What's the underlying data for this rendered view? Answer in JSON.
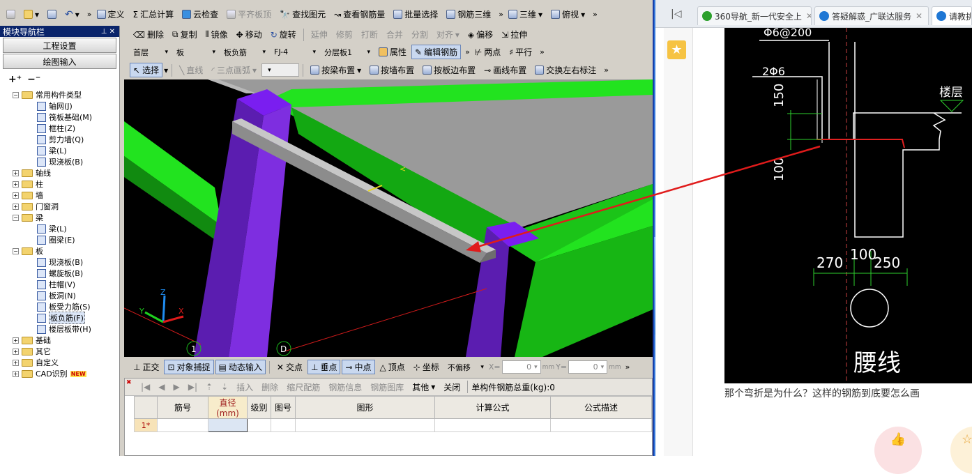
{
  "toolbar1": {
    "define": "定义",
    "sum_calc": "汇总计算",
    "cloud_check": "云检查",
    "level_top": "平齐板顶",
    "find_element": "查找图元",
    "view_rebar": "查看钢筋量",
    "batch_select": "批量选择",
    "rebar_3d": "钢筋三维",
    "view_mode": "三维",
    "view_dir": "俯视"
  },
  "toolbar2": {
    "delete": "删除",
    "copy": "复制",
    "mirror": "镜像",
    "move": "移动",
    "rotate": "旋转",
    "extend": "延伸",
    "trim": "修剪",
    "break": "打断",
    "merge": "合并",
    "split": "分割",
    "align": "对齐",
    "offset": "偏移",
    "stretch": "拉伸"
  },
  "toolbar3": {
    "floor": "首层",
    "type": "板",
    "subtype": "板负筋",
    "component": "FJ-4",
    "layer": "分层板1",
    "properties": "属性",
    "edit_rebar": "编辑钢筋",
    "two_points": "两点",
    "parallel": "平行"
  },
  "toolbar4": {
    "select": "选择",
    "line": "直线",
    "arc": "三点画弧",
    "by_beam": "按梁布置",
    "by_wall": "按墙布置",
    "by_slab_edge": "按板边布置",
    "draw_line": "画线布置",
    "swap_labels": "交换左右标注"
  },
  "nav": {
    "title": "模块导航栏",
    "project_settings": "工程设置",
    "drawing_input": "绘图输入",
    "tree": [
      {
        "label": "常用构件类型",
        "level": 0,
        "expanded": true,
        "children": [
          {
            "label": "轴网(J)"
          },
          {
            "label": "筏板基础(M)"
          },
          {
            "label": "框柱(Z)"
          },
          {
            "label": "剪力墙(Q)"
          },
          {
            "label": "梁(L)"
          },
          {
            "label": "现浇板(B)"
          }
        ]
      },
      {
        "label": "轴线",
        "level": 0,
        "expanded": false
      },
      {
        "label": "柱",
        "level": 0,
        "expanded": false
      },
      {
        "label": "墙",
        "level": 0,
        "expanded": false
      },
      {
        "label": "门窗洞",
        "level": 0,
        "expanded": false
      },
      {
        "label": "梁",
        "level": 0,
        "expanded": true,
        "children": [
          {
            "label": "梁(L)"
          },
          {
            "label": "圈梁(E)"
          }
        ]
      },
      {
        "label": "板",
        "level": 0,
        "expanded": true,
        "children": [
          {
            "label": "现浇板(B)"
          },
          {
            "label": "螺旋板(B)"
          },
          {
            "label": "柱帽(V)"
          },
          {
            "label": "板洞(N)"
          },
          {
            "label": "板受力筋(S)"
          },
          {
            "label": "板负筋(F)"
          },
          {
            "label": "楼层板带(H)"
          }
        ]
      },
      {
        "label": "基础",
        "level": 0,
        "expanded": false
      },
      {
        "label": "其它",
        "level": 0,
        "expanded": false
      },
      {
        "label": "自定义",
        "level": 0,
        "expanded": false
      },
      {
        "label": "CAD识别",
        "level": 0,
        "expanded": false,
        "badge": "NEW"
      }
    ]
  },
  "viewport": {
    "axis_1": "1",
    "axis_d": "D",
    "axes_z": "Z",
    "axes_y": "Y",
    "axes_x": "X"
  },
  "snapbar": {
    "ortho": "正交",
    "object_snap": "对象捕捉",
    "dynamic_input": "动态输入",
    "intersect": "交点",
    "perp": "垂点",
    "mid": "中点",
    "vertex": "顶点",
    "coord": "坐标",
    "offset_mode": "不偏移",
    "x_label": "X=",
    "x_value": "0",
    "y_label": "Y=",
    "y_value": "0",
    "unit": "mm"
  },
  "grid": {
    "toolbar": {
      "insert": "插入",
      "delete": "删除",
      "scale_rebar": "缩尺配筋",
      "rebar_info": "钢筋信息",
      "rebar_lib": "钢筋图库",
      "other": "其他",
      "close": "关闭",
      "total_weight": "单构件钢筋总重(kg):0"
    },
    "headers": [
      "筋号",
      "直径(mm)",
      "级别",
      "图号",
      "图形",
      "计算公式",
      "公式描述"
    ],
    "rows": [
      {
        "num": "1*",
        "cells": [
          "",
          "",
          "",
          "",
          "",
          "",
          ""
        ]
      }
    ]
  },
  "browser": {
    "tabs": [
      {
        "label": "360导航_新一代安全上",
        "favicon_color": "#2ca02c"
      },
      {
        "label": "答疑解惑_广联达服务",
        "favicon_color": "#1f77d4"
      },
      {
        "label": "请教挑",
        "favicon_color": "#1f77d4"
      }
    ],
    "cad_labels": {
      "rebar1": "Φ6@200",
      "rebar2": "2Φ6",
      "dim_150": "150",
      "dim_100_v": "100",
      "floor_label": "楼层",
      "dim_270": "270",
      "dim_100": "100",
      "dim_250": "250",
      "waist_line": "腰线"
    },
    "question": "那个弯折是为什么？这样的钢筋到底要怎么画"
  },
  "colors": {
    "accent": "#0a246a",
    "beam": "#20e01e",
    "column": "#6a21c8",
    "arrow": "#e01b1b"
  }
}
